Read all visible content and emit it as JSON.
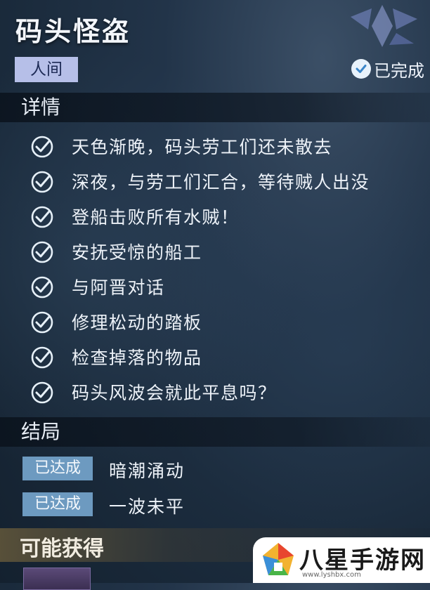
{
  "quest": {
    "title": "码头怪盗",
    "realm": "人间",
    "status": "已完成"
  },
  "details": {
    "heading": "详情",
    "tasks": [
      {
        "text": "天色渐晚，码头劳工们还未散去",
        "completed": true
      },
      {
        "text": "深夜，与劳工们汇合，等待贼人出没",
        "completed": true
      },
      {
        "text": "登船击败所有水贼！",
        "completed": true
      },
      {
        "text": "安抚受惊的船工",
        "completed": true
      },
      {
        "text": "与阿晋对话",
        "completed": true
      },
      {
        "text": "修理松动的踏板",
        "completed": true
      },
      {
        "text": "检查掉落的物品",
        "completed": true
      },
      {
        "text": "码头风波会就此平息吗？",
        "completed": true
      }
    ]
  },
  "endings": {
    "heading": "结局",
    "items": [
      {
        "badge": "已达成",
        "text": "暗潮涌动"
      },
      {
        "badge": "已达成",
        "text": "一波未平"
      }
    ]
  },
  "rewards": {
    "heading": "可能获得"
  },
  "watermark": {
    "brand": "八星手游网",
    "url": "www.lyshbx.com"
  },
  "icons": {
    "task_check": "checkmark-circle-icon",
    "status_check": "check-badge-icon",
    "emblem": "crystal-emblem-icon"
  },
  "colors": {
    "realm_tag_bg": "#b6bfe8",
    "ending_badge_bg": "#6d9ac0",
    "check_color": "#e6f0f8"
  }
}
